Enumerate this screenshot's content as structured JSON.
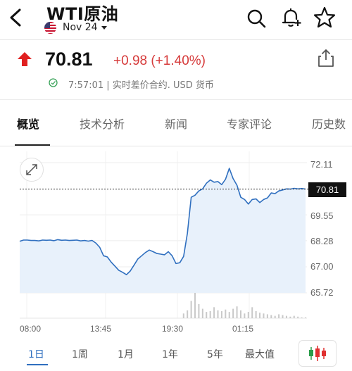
{
  "header": {
    "title": "WTI原油",
    "contract": "Nov 24"
  },
  "quote": {
    "price": "70.81",
    "change": "+0.98 (+1.40%)",
    "status": "7:57:01 | 实时差价合约.  USD 货币",
    "accent_up": "#d63a3a"
  },
  "tabs": [
    {
      "label": "概览",
      "active": true
    },
    {
      "label": "技术分析",
      "active": false
    },
    {
      "label": "新闻",
      "active": false
    },
    {
      "label": "专家评论",
      "active": false
    },
    {
      "label": "历史数",
      "active": false
    }
  ],
  "chart_data": {
    "type": "area",
    "y_ticks": [
      "72.11",
      "69.55",
      "68.28",
      "67.00",
      "65.72"
    ],
    "x_ticks": [
      "08:00",
      "13:45",
      "19:30",
      "01:15"
    ],
    "ylim": [
      65.72,
      72.11
    ],
    "last_value": "70.81",
    "grid": true,
    "series": [
      {
        "values": [
          68.25,
          68.31,
          68.31,
          68.29,
          68.29,
          68.27,
          68.31,
          68.3,
          68.31,
          68.28,
          68.33,
          68.3,
          68.31,
          68.29,
          68.3,
          68.31,
          68.27,
          68.29,
          68.26,
          68.29,
          68.16,
          67.95,
          67.54,
          67.48,
          67.23,
          67.03,
          66.83,
          66.73,
          66.61,
          66.79,
          67.08,
          67.38,
          67.54,
          67.7,
          67.82,
          67.74,
          67.65,
          67.62,
          67.59,
          67.74,
          67.54,
          67.16,
          67.2,
          67.51,
          68.65,
          70.41,
          70.51,
          70.72,
          70.82,
          71.1,
          71.26,
          71.15,
          71.18,
          71.03,
          71.29,
          71.83,
          71.33,
          71.0,
          70.41,
          70.3,
          70.08,
          70.3,
          70.33,
          70.15,
          70.3,
          70.38,
          70.62,
          70.59,
          70.72,
          70.77,
          70.82,
          70.81,
          70.85,
          70.82,
          70.84,
          70.81
        ]
      }
    ],
    "volume": [
      0,
      0,
      0,
      0,
      0,
      0,
      0,
      0,
      0,
      0,
      0,
      0,
      0,
      0,
      0,
      0,
      0,
      0,
      0,
      0,
      0,
      0,
      0,
      0,
      0,
      0,
      0,
      0,
      0,
      0,
      0,
      0,
      0,
      0,
      0,
      0,
      0,
      0,
      0,
      0,
      0,
      0,
      0,
      6,
      10,
      22,
      34,
      18,
      12,
      8,
      9,
      14,
      10,
      9,
      11,
      8,
      12,
      15,
      10,
      6,
      8,
      14,
      9,
      7,
      6,
      5,
      4,
      3,
      5,
      4,
      3,
      2,
      3,
      2,
      1,
      1
    ],
    "accent": "#2f6fbf"
  },
  "ranges": [
    {
      "label": "1日",
      "active": true
    },
    {
      "label": "1周",
      "active": false
    },
    {
      "label": "1月",
      "active": false
    },
    {
      "label": "1年",
      "active": false
    },
    {
      "label": "5年",
      "active": false
    },
    {
      "label": "最大值",
      "active": false
    }
  ],
  "icons": {
    "back": "chevron-left-icon",
    "search": "search-icon",
    "alert": "bell-plus-icon",
    "favorite": "star-icon",
    "share": "share-icon",
    "expand": "expand-icon",
    "candles": "candlestick-icon"
  }
}
